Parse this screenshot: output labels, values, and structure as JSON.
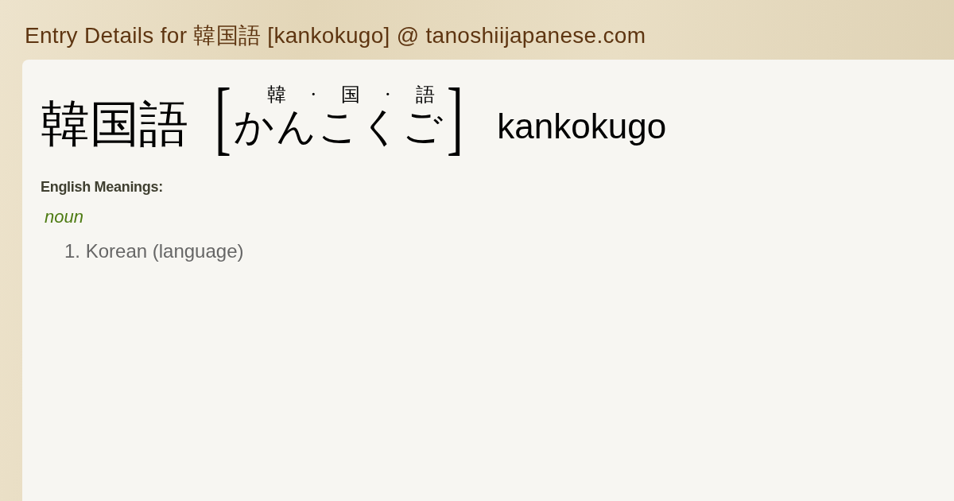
{
  "page_title": "Entry Details for 韓国語 [kankokugo] @ tanoshiijapanese.com",
  "entry": {
    "headword": "韓国語",
    "open_bracket": "[",
    "furigana": [
      "韓",
      "·",
      "国",
      "·",
      "語"
    ],
    "reading": "かんこくご",
    "close_bracket": "]",
    "romaji": "kankokugo"
  },
  "meanings": {
    "heading": "English Meanings:",
    "groups": [
      {
        "part_of_speech": "noun",
        "senses": [
          "1. Korean (language)"
        ]
      }
    ]
  }
}
